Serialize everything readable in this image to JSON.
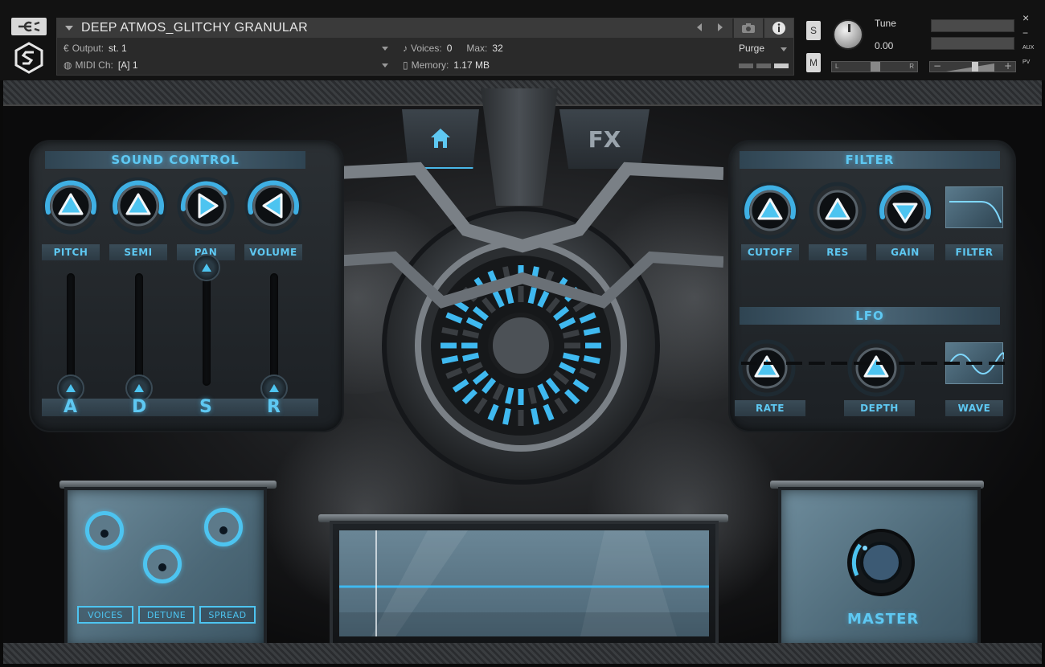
{
  "header": {
    "instrument_name": "DEEP ATMOS_GLITCHY GRANULAR",
    "output_label": "Output:",
    "output_value": "st. 1",
    "midi_label": "MIDI Ch:",
    "midi_value": "[A]  1",
    "voices_label": "Voices:",
    "voices_value": "0",
    "max_label": "Max:",
    "max_value": "32",
    "memory_label": "Memory:",
    "memory_value": "1.17 MB",
    "purge_label": "Purge",
    "solo_label": "S",
    "mute_label": "M",
    "tune_label": "Tune",
    "tune_value": "0.00",
    "pan_left": "L",
    "pan_right": "R",
    "vol_minus": "−",
    "vol_plus": "+",
    "close_label": "×",
    "minimize_label": "−",
    "aux_label": "AUX",
    "pv_label": "PV"
  },
  "tabs": {
    "home_icon": "home-icon",
    "fx_label": "FX"
  },
  "sound_control": {
    "title": "SOUND CONTROL",
    "knobs": [
      {
        "label": "PITCH",
        "arrow": "up"
      },
      {
        "label": "SEMI",
        "arrow": "up"
      },
      {
        "label": "PAN",
        "arrow": "right"
      },
      {
        "label": "VOLUME",
        "arrow": "left"
      }
    ],
    "adsr_letters": [
      "A",
      "D",
      "S",
      "R"
    ],
    "fader_levels": [
      0.0,
      0.0,
      1.0,
      0.0
    ]
  },
  "filter": {
    "title": "FILTER",
    "knobs": [
      {
        "label": "CUTOFF",
        "arrow": "up"
      },
      {
        "label": "RES",
        "arrow": "up"
      },
      {
        "label": "GAIN",
        "arrow": "down"
      }
    ],
    "display_label": "FILTER"
  },
  "lfo": {
    "title": "LFO",
    "knobs": [
      {
        "label": "RATE",
        "arrow": "up"
      },
      {
        "label": "DEPTH",
        "arrow": "up"
      }
    ],
    "wave_label": "WAVE"
  },
  "unison": {
    "buttons": [
      "VOICES",
      "DETUNE",
      "SPREAD"
    ]
  },
  "master": {
    "label": "MASTER"
  },
  "colors": {
    "accent": "#4dc4f0",
    "panel_bg": "#23282c"
  }
}
